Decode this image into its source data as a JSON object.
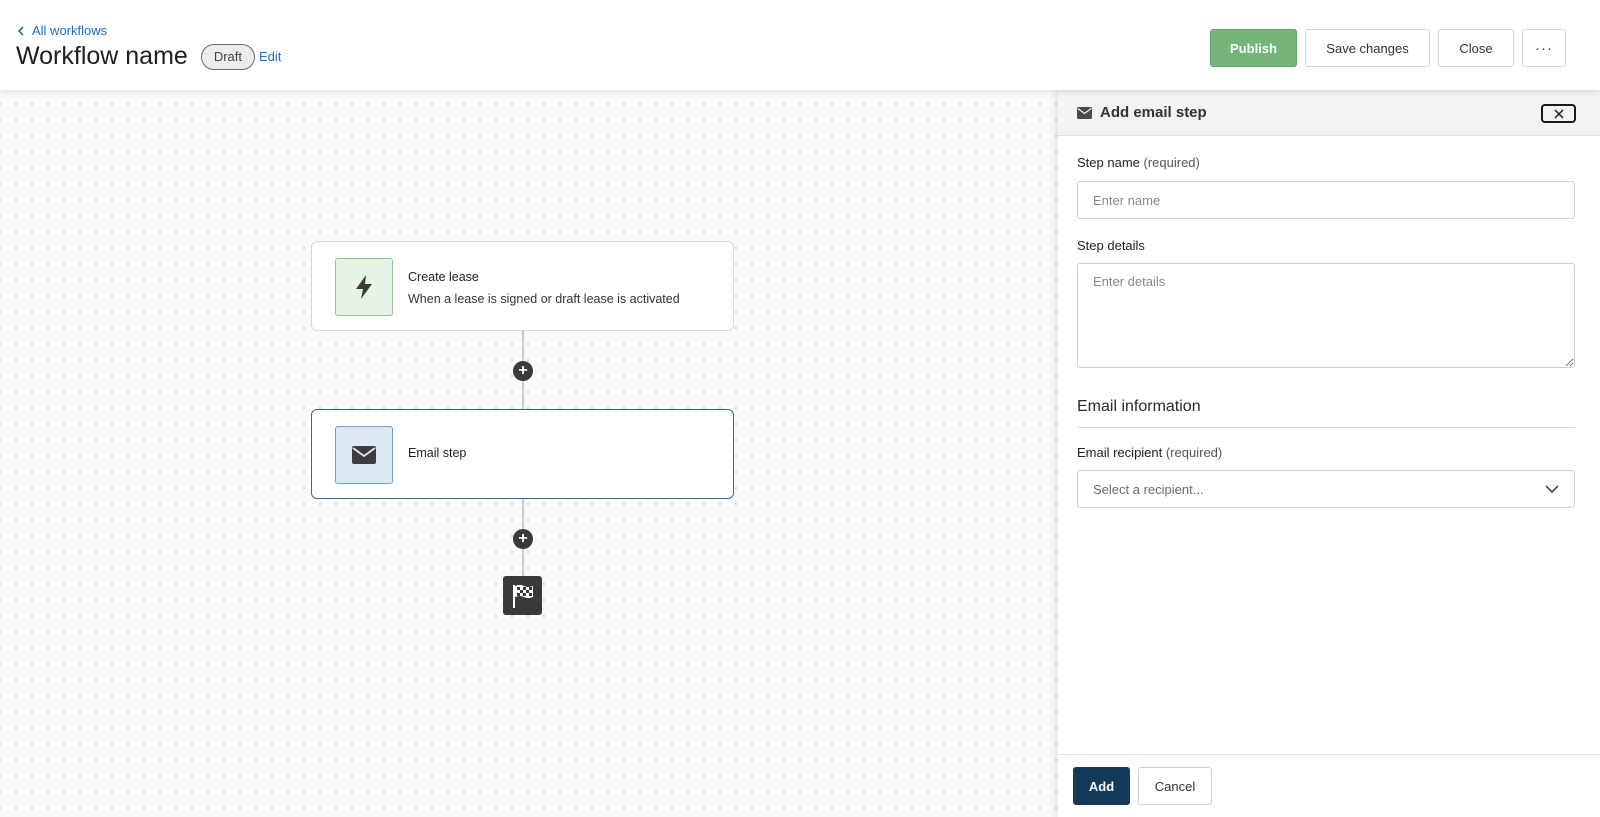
{
  "header": {
    "back_link": "All workflows",
    "title": "Workflow name",
    "status_badge": "Draft",
    "edit_link": "Edit",
    "buttons": {
      "publish": "Publish",
      "save": "Save changes",
      "close": "Close",
      "more": "···"
    },
    "publish_color": "#74b47a"
  },
  "canvas": {
    "nodes": [
      {
        "title": "Create lease",
        "subtitle": "When a lease is signed or draft lease is activated",
        "icon": "lightning-icon"
      },
      {
        "title": "Email step",
        "icon": "envelope-icon",
        "selected": true
      }
    ],
    "add_step_symbol": "+",
    "end_icon": "checkered-flag-icon"
  },
  "panel": {
    "title": "Add email step",
    "title_icon": "envelope-icon",
    "step_name": {
      "label": "Step name",
      "required": "(required)",
      "placeholder": "Enter name",
      "value": ""
    },
    "step_details": {
      "label": "Step details",
      "placeholder": "Enter details",
      "value": ""
    },
    "section_title": "Email information",
    "email_recipient": {
      "label": "Email recipient",
      "required": "(required)",
      "placeholder": "Select a recipient..."
    },
    "footer": {
      "add": "Add",
      "cancel": "Cancel"
    },
    "primary_color": "#143a5a"
  }
}
